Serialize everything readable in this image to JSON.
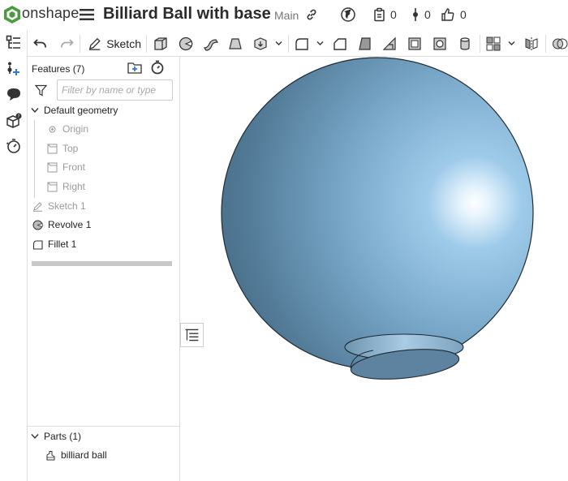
{
  "app": {
    "brand": "onshape"
  },
  "document": {
    "title": "Billiard Ball with base",
    "branch": "Main"
  },
  "topbar": {
    "versions_count": "0",
    "branches_count": "0",
    "likes_count": "0"
  },
  "toolbar": {
    "sketch_label": "Sketch"
  },
  "feature_panel": {
    "title": "Features (7)",
    "filter_placeholder": "Filter by name or type",
    "default_geometry_label": "Default geometry",
    "default_geometry_items": [
      {
        "label": "Origin",
        "icon": "origin-icon"
      },
      {
        "label": "Top",
        "icon": "plane-icon"
      },
      {
        "label": "Front",
        "icon": "plane-icon"
      },
      {
        "label": "Right",
        "icon": "plane-icon"
      }
    ],
    "features": [
      {
        "label": "Sketch 1",
        "icon": "sketch-icon",
        "suppressed_style": true
      },
      {
        "label": "Revolve 1",
        "icon": "revolve-icon",
        "suppressed_style": false
      },
      {
        "label": "Fillet 1",
        "icon": "fillet-icon",
        "suppressed_style": false
      }
    ],
    "parts_title": "Parts (1)",
    "parts": [
      {
        "label": "billiard ball",
        "icon": "part-icon"
      }
    ]
  },
  "model": {
    "color": "#6a97b8",
    "edge_color": "#1f2a33"
  }
}
